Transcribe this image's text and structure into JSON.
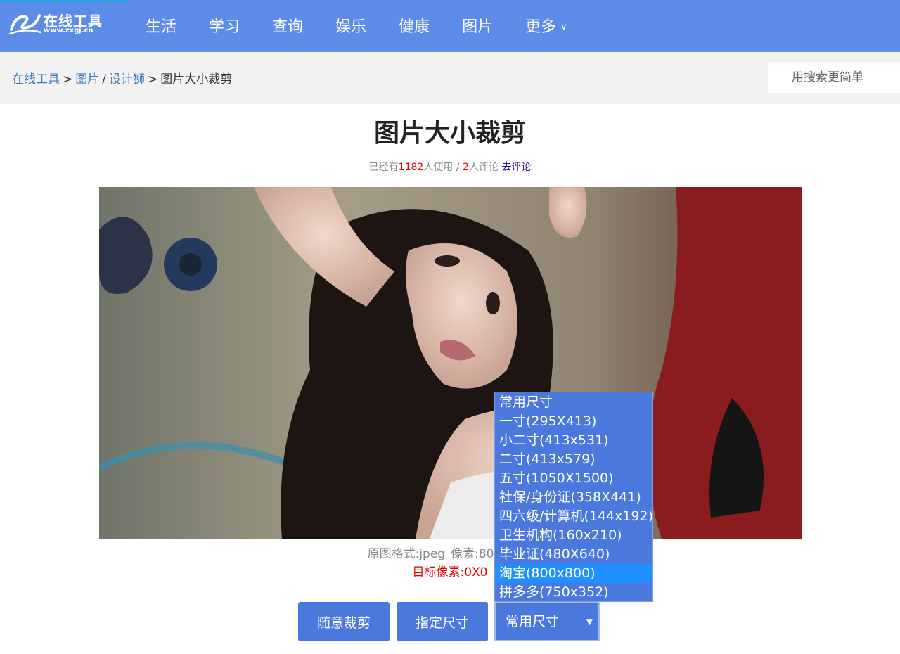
{
  "header": {
    "logo_text": "在线工具",
    "logo_url_text": "www.zxgj.cn",
    "nav": [
      "生活",
      "学习",
      "查询",
      "娱乐",
      "健康",
      "图片",
      "更多"
    ]
  },
  "breadcrumb": {
    "home": "在线工具",
    "sep1": ">",
    "cat": "图片",
    "sep2": "/",
    "sub": "设计狮",
    "sep3": ">",
    "current": "图片大小裁剪"
  },
  "search": {
    "placeholder": "用搜索更简单"
  },
  "page": {
    "title": "图片大小裁剪",
    "stats_prefix": "已经有",
    "uses": "1182",
    "uses_suffix": "人使用 /",
    "comments": "2",
    "comments_suffix": "人评论",
    "comment_link": "去评论",
    "format_info": "原图格式:jpeg",
    "pixel_info": "像素:800X400",
    "target_pixels": "目标像素:0X0"
  },
  "buttons": {
    "free_crop": "随意裁剪",
    "fixed_size": "指定尺寸",
    "select_value": "常用尺寸",
    "select_arrow": "▼"
  },
  "dropdown": {
    "options": [
      "常用尺寸",
      "一寸(295X413)",
      "小二寸(413x531)",
      "二寸(413x579)",
      "五寸(1050X1500)",
      "社保/身份证(358X441)",
      "四六级/计算机(144x192)",
      "卫生机构(160x210)",
      "毕业证(480X640)",
      "淘宝(800x800)",
      "拼多多(750x352)"
    ],
    "highlighted_index": 9
  },
  "colors": {
    "header": "#5d8be8",
    "button": "#4a78dc",
    "highlight": "#1e90ff",
    "red": "#e00000"
  }
}
